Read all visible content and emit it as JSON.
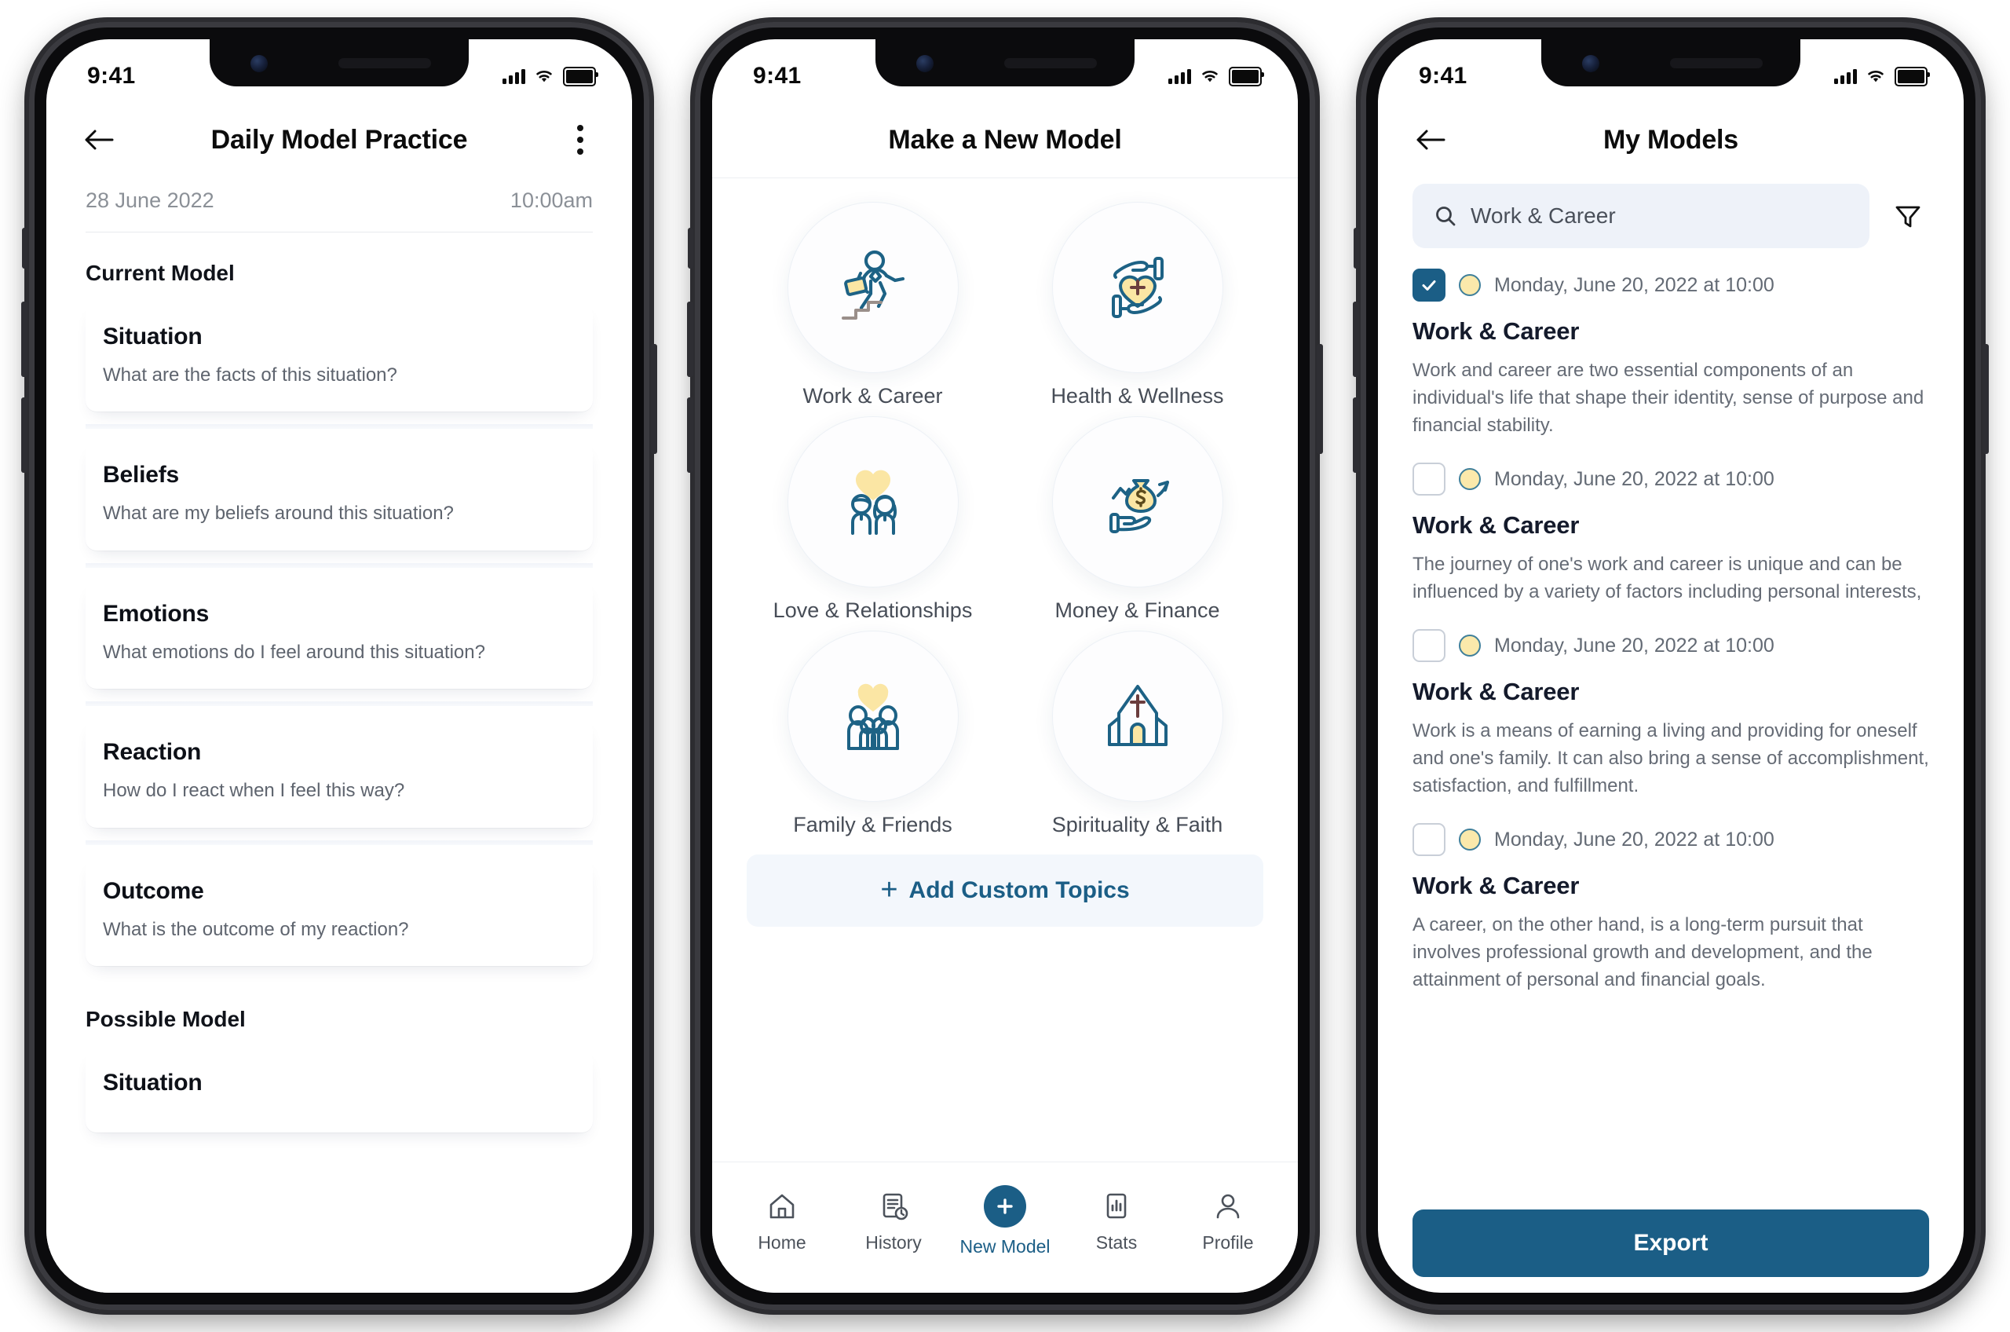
{
  "status_bar": {
    "time": "9:41",
    "icons": [
      "cellular-icon",
      "wifi-icon",
      "battery-icon"
    ]
  },
  "colors": {
    "brand_blue": "#1b5e86",
    "accent_yellow": "#fbe9ab",
    "muted_text": "#656b75",
    "search_bg": "#eef2f9"
  },
  "screen1": {
    "nav": {
      "back_icon": "arrow-left-icon",
      "title": "Daily Model Practice",
      "menu_icon": "overflow-menu-icon"
    },
    "date": "28 June 2022",
    "time": "10:00am",
    "sections": [
      {
        "heading": "Current Model",
        "cards": [
          {
            "title": "Situation",
            "prompt": "What are the facts of this situation?"
          },
          {
            "title": "Beliefs",
            "prompt": "What are my beliefs around this situation?"
          },
          {
            "title": "Emotions",
            "prompt": "What emotions do I feel around this situation?"
          },
          {
            "title": "Reaction",
            "prompt": "How do I react when I feel this way?"
          },
          {
            "title": "Outcome",
            "prompt": "What is the outcome of my reaction?"
          }
        ]
      },
      {
        "heading": "Possible Model",
        "cards": [
          {
            "title": "Situation",
            "prompt": ""
          }
        ]
      }
    ]
  },
  "screen2": {
    "nav": {
      "title": "Make a New Model"
    },
    "topics": [
      {
        "label": "Work & Career",
        "icon": "briefcase-person-stairs-icon"
      },
      {
        "label": "Health & Wellness",
        "icon": "hands-heart-plus-icon"
      },
      {
        "label": "Love & Relationships",
        "icon": "couple-heart-icon"
      },
      {
        "label": "Money & Finance",
        "icon": "money-bag-hand-icon"
      },
      {
        "label": "Family & Friends",
        "icon": "family-heart-icon"
      },
      {
        "label": "Spirituality & Faith",
        "icon": "church-cross-icon"
      }
    ],
    "add_custom": {
      "label": "Add Custom Topics",
      "icon": "plus-icon"
    },
    "tabs": [
      {
        "label": "Home",
        "icon": "home-icon",
        "active": false
      },
      {
        "label": "History",
        "icon": "history-doc-icon",
        "active": false
      },
      {
        "label": "New Model",
        "icon": "plus-circle-icon",
        "active": true
      },
      {
        "label": "Stats",
        "icon": "bar-chart-icon",
        "active": false
      },
      {
        "label": "Profile",
        "icon": "person-icon",
        "active": false
      }
    ]
  },
  "screen3": {
    "nav": {
      "back_icon": "arrow-left-icon",
      "title": "My Models"
    },
    "search": {
      "value": "Work & Career",
      "placeholder": "Work & Career",
      "icon": "search-icon"
    },
    "filter_icon": "filter-funnel-icon",
    "items": [
      {
        "checked": true,
        "date": "Monday, June 20, 2022 at 10:00",
        "title": "Work & Career",
        "desc": "Work and career are two essential components of an individual's life that shape their identity, sense of purpose and financial stability."
      },
      {
        "checked": false,
        "date": "Monday, June 20, 2022 at 10:00",
        "title": "Work & Career",
        "desc": "The journey of one's work and career is unique and can be influenced by a variety of factors including personal interests,"
      },
      {
        "checked": false,
        "date": "Monday, June 20, 2022 at 10:00",
        "title": "Work & Career",
        "desc": "Work is a means of earning a living and providing for oneself and one's family. It can also bring a sense of accomplishment, satisfaction, and fulfillment."
      },
      {
        "checked": false,
        "date": "Monday, June 20, 2022 at 10:00",
        "title": "Work & Career",
        "desc": "A career, on the other hand, is a long-term pursuit that involves professional growth and development, and the attainment of personal and financial goals."
      }
    ],
    "export": {
      "label": "Export"
    }
  }
}
